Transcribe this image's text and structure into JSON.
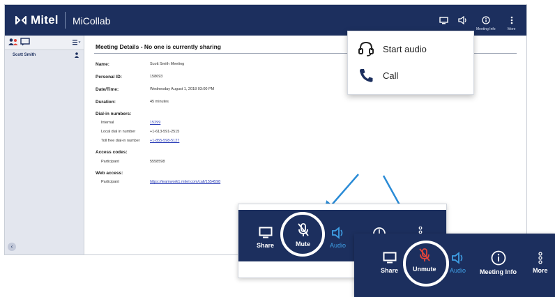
{
  "app": {
    "brand": "Mitel",
    "name": "MiCollab",
    "top_icons": [
      {
        "icon": "monitor-icon",
        "label": ""
      },
      {
        "icon": "speaker-icon",
        "label": ""
      },
      {
        "icon": "info-icon",
        "label": "Meeting Info"
      },
      {
        "icon": "more-icon",
        "label": "More"
      }
    ]
  },
  "sidebar": {
    "participants": [
      "Scott Smith"
    ]
  },
  "meeting": {
    "title": "Meeting Details - No one is currently sharing",
    "name_label": "Name:",
    "name_value": "Scott Smith Meeting",
    "personal_id_label": "Personal ID:",
    "personal_id_value": "158693",
    "datetime_label": "Date/Time:",
    "datetime_value": "Wednesday August 1, 2018 03:00 PM",
    "duration_label": "Duration:",
    "duration_value": "45 minutes",
    "dialin_label": "Dial-in numbers:",
    "internal_label": "Internal",
    "internal_value": "15299",
    "local_label": "Local dial in number",
    "local_value": "+1-613-591-2515",
    "tollfree_label": "Toll free dial-in number",
    "tollfree_value": "+1-855-598-5127",
    "access_label": "Access codes:",
    "participant_label": "Participant",
    "participant_code": "5558598",
    "web_label": "Web access:",
    "web_participant_label": "Participant",
    "web_link": "https://teamwork1.mitel.com/call/1554598"
  },
  "popup": {
    "items": [
      {
        "icon": "headset-icon",
        "label": "Start audio"
      },
      {
        "icon": "phone-icon",
        "label": "Call"
      }
    ]
  },
  "toolbar1": {
    "share": "Share",
    "mute": "Mute",
    "audio": "Audio"
  },
  "toolbar2": {
    "share": "Share",
    "unmute": "Unmute",
    "audio": "Audio",
    "meeting_info": "Meeting Info",
    "more": "More"
  },
  "colors": {
    "navy": "#1c2f5e",
    "accent_blue": "#3fa0e6",
    "unmute_red": "#e0443a",
    "link": "#2c3fb8"
  }
}
